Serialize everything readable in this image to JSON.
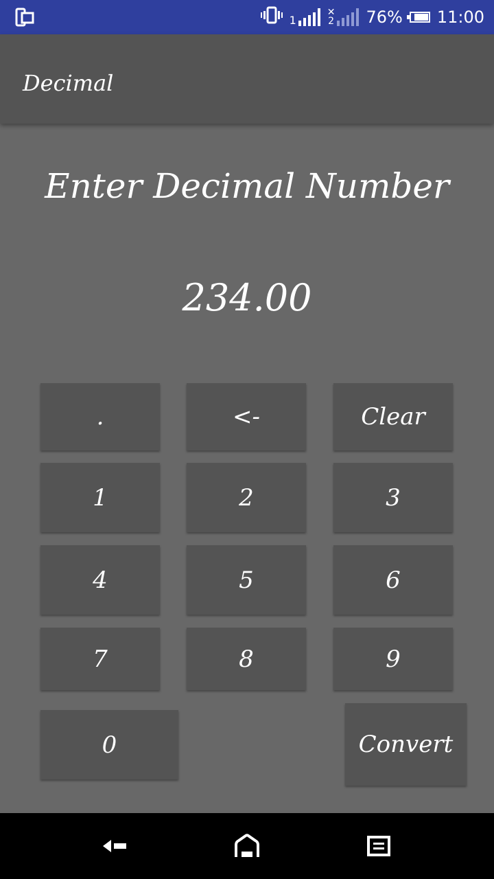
{
  "status_bar": {
    "battery_percent": "76%",
    "time": "11:00",
    "signal_sim1_label": "1",
    "signal_sim2_label": "2",
    "icons": [
      "screen-mirror-icon",
      "vibrate-icon",
      "signal-icon",
      "no-signal-icon",
      "battery-icon"
    ]
  },
  "app_bar": {
    "title": "Decimal"
  },
  "main": {
    "prompt": "Enter Decimal Number",
    "display_value": "234.00"
  },
  "keypad": {
    "dot": ".",
    "backspace": "<-",
    "clear": "Clear",
    "k1": "1",
    "k2": "2",
    "k3": "3",
    "k4": "4",
    "k5": "5",
    "k6": "6",
    "k7": "7",
    "k8": "8",
    "k9": "9",
    "k0": "0",
    "convert": "Convert"
  },
  "nav_bar": {
    "icons": [
      "back-icon",
      "home-icon",
      "recents-icon"
    ]
  },
  "colors": {
    "status_bar": "#2f3f9e",
    "app_bar": "#545454",
    "background": "#686868",
    "key": "#545454",
    "nav_bar": "#000000"
  }
}
